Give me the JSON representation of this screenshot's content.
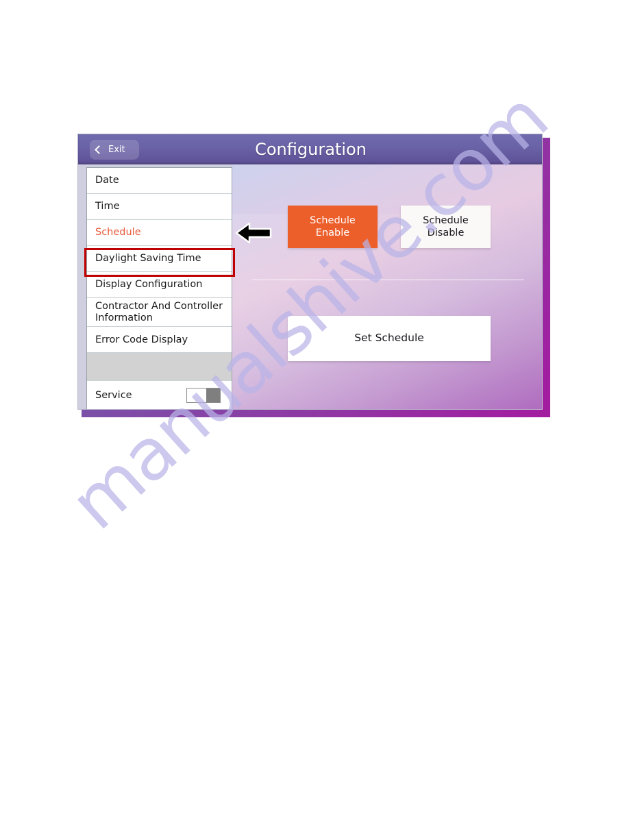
{
  "watermark": {
    "text": "manualshive.com"
  },
  "device": {
    "header": {
      "exit_label": "Exit",
      "back_icon": "chevron-left-icon",
      "title": "Configuration"
    },
    "menu": {
      "items": [
        {
          "label": "Date",
          "state": "normal"
        },
        {
          "label": "Time",
          "state": "normal"
        },
        {
          "label": "Schedule",
          "state": "selected"
        },
        {
          "label": "Daylight Saving Time",
          "state": "normal"
        },
        {
          "label": "Display Configuration",
          "state": "normal"
        },
        {
          "label": "Contractor And Controller Information",
          "state": "normal"
        },
        {
          "label": "Error Code Display",
          "state": "normal"
        },
        {
          "label": "",
          "state": "blank"
        },
        {
          "label": "Service",
          "state": "toggle",
          "toggle_value": "off"
        }
      ]
    },
    "content": {
      "schedule_enable_label": "Schedule\nEnable",
      "schedule_enable_line1": "Schedule",
      "schedule_enable_line2": "Enable",
      "schedule_disable_line1": "Schedule",
      "schedule_disable_line2": "Disable",
      "set_schedule_label": "Set Schedule"
    }
  },
  "annotations": {
    "highlight_box": {
      "target": "Schedule",
      "color": "#c00000"
    },
    "pointer_arrow": {
      "icon": "left-arrow-annotation",
      "color": "#000000"
    }
  },
  "colors": {
    "header_purple": "#6a62a6",
    "accent_orange": "#ec5f2b",
    "selected_text": "#e8593a",
    "annotation_red": "#c00000",
    "watermark_purple": "#b9b4e8"
  }
}
